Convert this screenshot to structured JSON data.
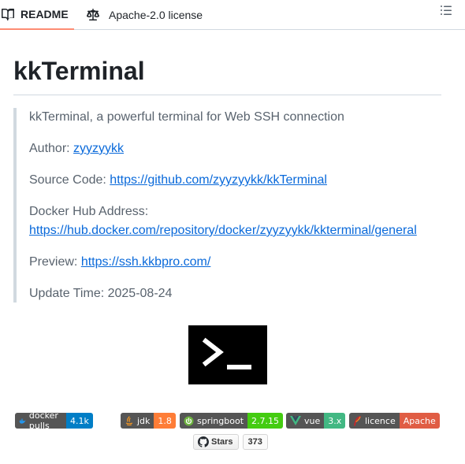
{
  "tabs": {
    "readme": "README",
    "license": "Apache-2.0 license"
  },
  "readme": {
    "title": "kkTerminal",
    "intro": "kkTerminal, a powerful terminal for Web SSH connection",
    "author_label": "Author:",
    "author_link": "zyyzyykk",
    "source_label": "Source Code:",
    "source_link": "https://github.com/zyyzyykk/kkTerminal",
    "docker_label": "Docker Hub Address:",
    "docker_link": "https://hub.docker.com/repository/docker/zyyzyykk/kkterminal/general",
    "preview_label": "Preview:",
    "preview_link": "https://ssh.kkbpro.com/",
    "update_time": "Update Time: 2025-08-24"
  },
  "badges": [
    {
      "label": "docker pulls",
      "value": "4.1k",
      "color": "#007ec6",
      "icon": "docker-icon"
    },
    {
      "label": "jdk",
      "value": "1.8",
      "color": "#fe7d37",
      "icon": "java-icon"
    },
    {
      "label": "springboot",
      "value": "2.7.15",
      "color": "#4c1",
      "icon": "spring-icon"
    },
    {
      "label": "vue",
      "value": "3.x",
      "color": "#42b883",
      "icon": "vue-icon"
    },
    {
      "label": "licence",
      "value": "Apache",
      "color": "#e05d44",
      "icon": "feather-icon"
    }
  ],
  "stars": {
    "label": "Stars",
    "count": "373"
  },
  "colors": {
    "link": "#0969da",
    "tab_underline": "#fd8c73",
    "muted_text": "#59636e"
  }
}
